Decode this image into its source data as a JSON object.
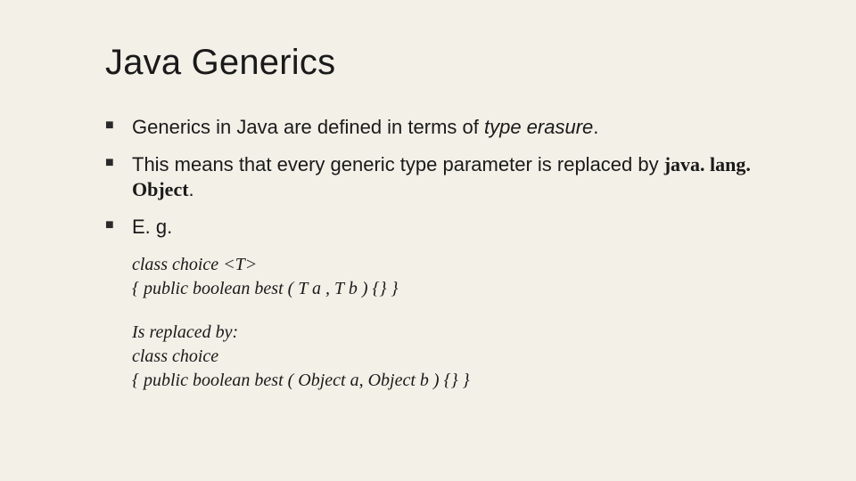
{
  "title": "Java Generics",
  "bullets": [
    {
      "pre": "Generics in Java are defined in terms of ",
      "em": "type erasure",
      "post": "."
    },
    {
      "pre": "This means that every generic type parameter is replaced by ",
      "obj": "java. lang. Object",
      "post": "."
    },
    {
      "text": "E. g."
    }
  ],
  "code": {
    "line1": "class choice <T>",
    "line2": "{   public boolean best ( T a ,  T b ) {} }",
    "repl_intro": "Is replaced by:",
    "line3": "class choice",
    "line4": "{   public boolean best ( Object a, Object b ) {} }"
  }
}
